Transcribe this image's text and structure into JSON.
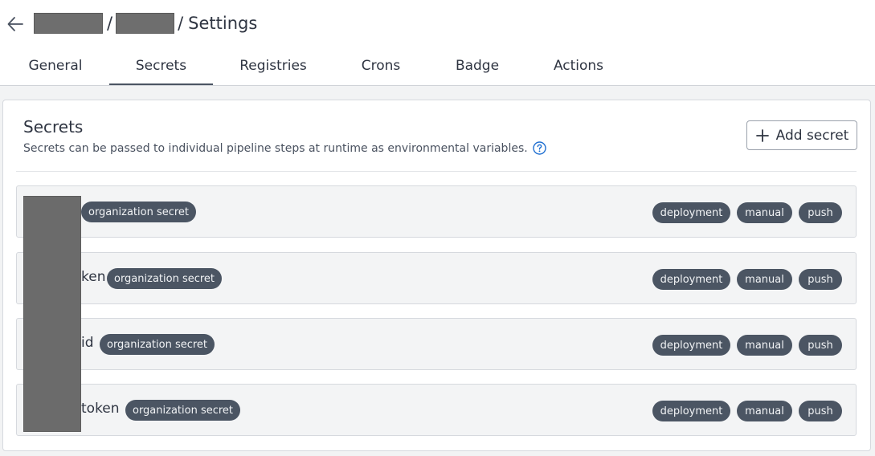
{
  "breadcrumb": {
    "separator": "/",
    "current": "Settings"
  },
  "tabs": [
    {
      "label": "General"
    },
    {
      "label": "Secrets"
    },
    {
      "label": "Registries"
    },
    {
      "label": "Crons"
    },
    {
      "label": "Badge"
    },
    {
      "label": "Actions"
    }
  ],
  "active_tab": "Secrets",
  "section": {
    "title": "Secrets",
    "description": "Secrets can be passed to individual pipeline steps at runtime as environmental variables.",
    "add_button_label": "Add secret"
  },
  "secrets": [
    {
      "name_visible": "",
      "scope": "organization secret",
      "events": [
        "deployment",
        "manual",
        "push"
      ]
    },
    {
      "name_visible": "ken",
      "scope": "organization secret",
      "events": [
        "deployment",
        "manual",
        "push"
      ]
    },
    {
      "name_visible": "id",
      "scope": "organization secret",
      "events": [
        "deployment",
        "manual",
        "push"
      ]
    },
    {
      "name_visible": "token",
      "scope": "organization secret",
      "events": [
        "deployment",
        "manual",
        "push"
      ]
    }
  ],
  "colors": {
    "accent": "#4b5563",
    "help_icon": "#1f6fd1",
    "redaction": "#6e6e6e"
  },
  "icons": {
    "back": "arrow-left-icon",
    "help": "question-circle-icon",
    "add": "plus-icon"
  }
}
